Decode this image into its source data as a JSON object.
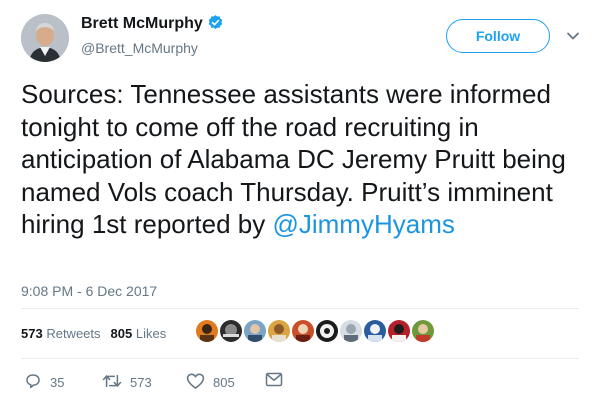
{
  "author": {
    "name": "Brett McMurphy",
    "handle": "@Brett_McMurphy",
    "verified": true
  },
  "follow_label": "Follow",
  "tweet": {
    "text": "Sources: Tennessee assistants were informed tonight to come off the road recruiting in anticipation of Alabama DC Jeremy Pruitt being named Vols coach Thursday. Pruitt’s imminent hiring 1st reported by ",
    "mention": "@JimmyHyams",
    "timestamp": "9:08 PM - 6 Dec 2017"
  },
  "stats": {
    "retweets_count": "573",
    "retweets_label": "Retweets",
    "likes_count": "805",
    "likes_label": "Likes"
  },
  "actions": {
    "replies": "35",
    "retweets": "573",
    "likes": "805"
  },
  "colors": {
    "accent": "#1da1f2",
    "mention": "#1b95e0",
    "muted": "#657786"
  }
}
